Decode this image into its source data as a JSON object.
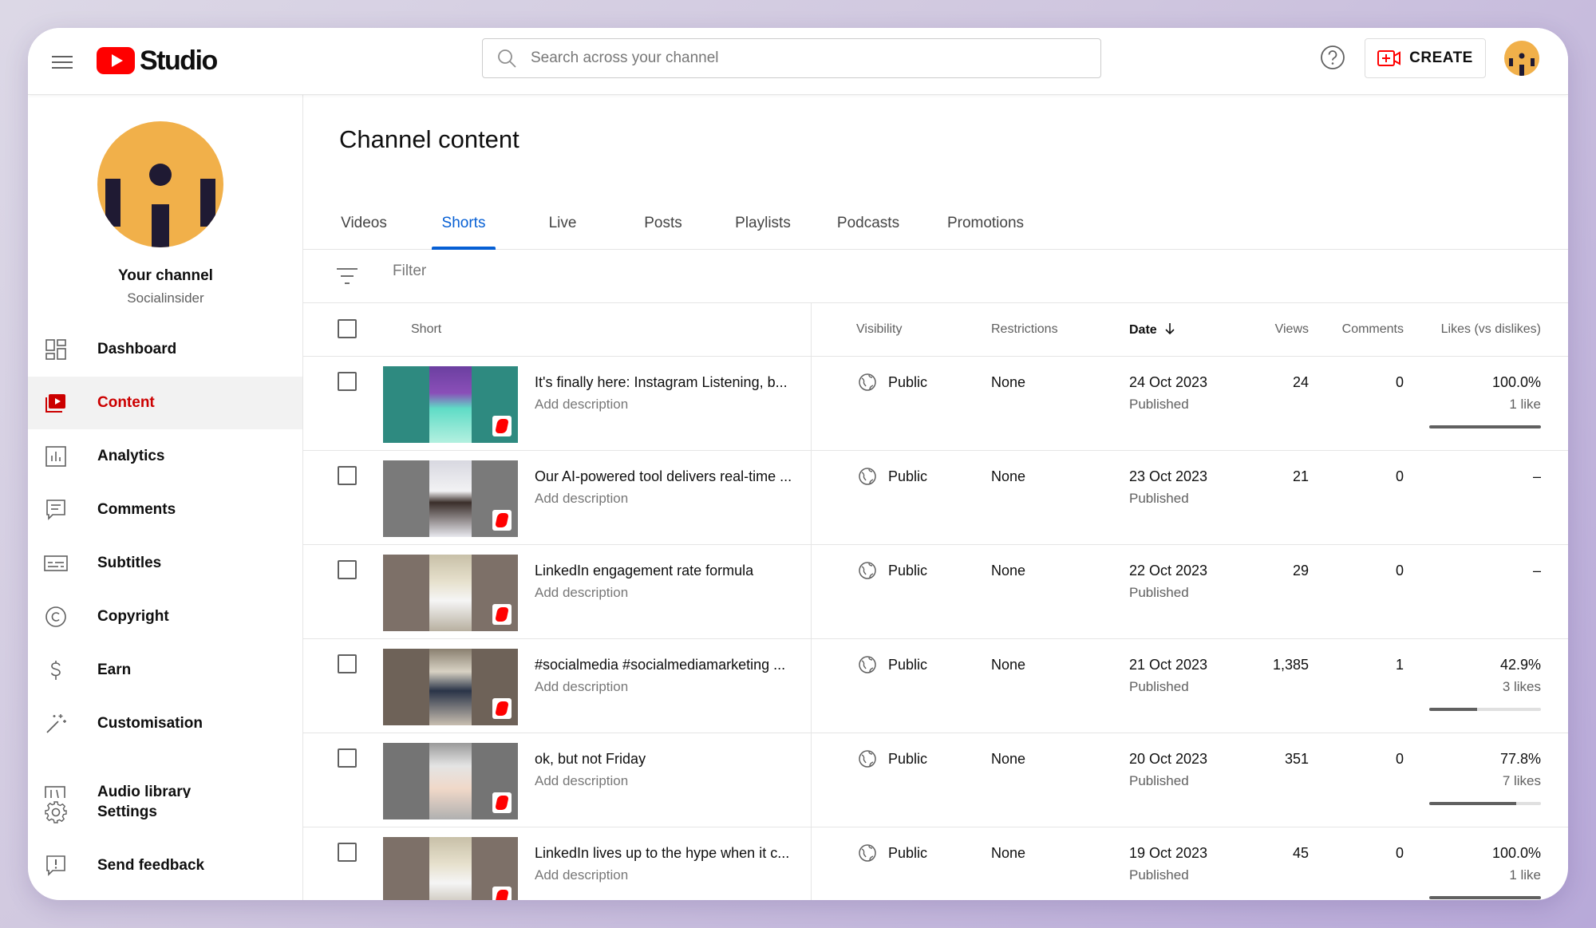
{
  "app": {
    "logo_text": "Studio",
    "search_placeholder": "Search across your channel",
    "create_label": "CREATE",
    "brand_color": "#ff0000",
    "accent_color": "#065fd4"
  },
  "channel": {
    "name": "Your channel",
    "handle": "Socialinsider"
  },
  "sidebar": {
    "items": [
      {
        "label": "Dashboard",
        "icon": "dashboard-icon"
      },
      {
        "label": "Content",
        "icon": "content-icon",
        "active": true
      },
      {
        "label": "Analytics",
        "icon": "analytics-icon"
      },
      {
        "label": "Comments",
        "icon": "comments-icon"
      },
      {
        "label": "Subtitles",
        "icon": "subtitles-icon"
      },
      {
        "label": "Copyright",
        "icon": "copyright-icon"
      },
      {
        "label": "Earn",
        "icon": "earn-icon"
      },
      {
        "label": "Customisation",
        "icon": "customisation-icon"
      },
      {
        "label": "Audio library",
        "icon": "audio-library-icon"
      },
      {
        "label": "Settings",
        "icon": "settings-icon"
      },
      {
        "label": "Send feedback",
        "icon": "feedback-icon"
      }
    ]
  },
  "main": {
    "title": "Channel content",
    "tabs": [
      "Videos",
      "Shorts",
      "Live",
      "Posts",
      "Playlists",
      "Podcasts",
      "Promotions"
    ],
    "active_tab": "Shorts",
    "filter_placeholder": "Filter",
    "columns": {
      "short": "Short",
      "visibility": "Visibility",
      "restrictions": "Restrictions",
      "date": "Date",
      "views": "Views",
      "comments": "Comments",
      "likes": "Likes (vs dislikes)"
    },
    "rows": [
      {
        "title": "It's finally here: Instagram Listening, b...",
        "description": "Add description",
        "visibility": "Public",
        "restrictions": "None",
        "date": "24 Oct 2023",
        "status": "Published",
        "views": "24",
        "comments": "0",
        "likes_pct": "100.0%",
        "likes_count": "1 like",
        "like_ratio": 1.0
      },
      {
        "title": "Our AI-powered tool delivers real-time ...",
        "description": "Add description",
        "visibility": "Public",
        "restrictions": "None",
        "date": "23 Oct 2023",
        "status": "Published",
        "views": "21",
        "comments": "0",
        "likes_pct": "–",
        "likes_count": "",
        "like_ratio": null
      },
      {
        "title": "LinkedIn engagement rate formula",
        "description": "Add description",
        "visibility": "Public",
        "restrictions": "None",
        "date": "22 Oct 2023",
        "status": "Published",
        "views": "29",
        "comments": "0",
        "likes_pct": "–",
        "likes_count": "",
        "like_ratio": null
      },
      {
        "title": "#socialmedia #socialmediamarketing ...",
        "description": "Add description",
        "visibility": "Public",
        "restrictions": "None",
        "date": "21 Oct 2023",
        "status": "Published",
        "views": "1,385",
        "comments": "1",
        "likes_pct": "42.9%",
        "likes_count": "3 likes",
        "like_ratio": 0.429
      },
      {
        "title": "ok, but not Friday",
        "description": "Add description",
        "visibility": "Public",
        "restrictions": "None",
        "date": "20 Oct 2023",
        "status": "Published",
        "views": "351",
        "comments": "0",
        "likes_pct": "77.8%",
        "likes_count": "7 likes",
        "like_ratio": 0.778
      },
      {
        "title": "LinkedIn lives up to the hype when it c...",
        "description": "Add description",
        "visibility": "Public",
        "restrictions": "None",
        "date": "19 Oct 2023",
        "status": "Published",
        "views": "45",
        "comments": "0",
        "likes_pct": "100.0%",
        "likes_count": "1 like",
        "like_ratio": 1.0
      }
    ]
  }
}
